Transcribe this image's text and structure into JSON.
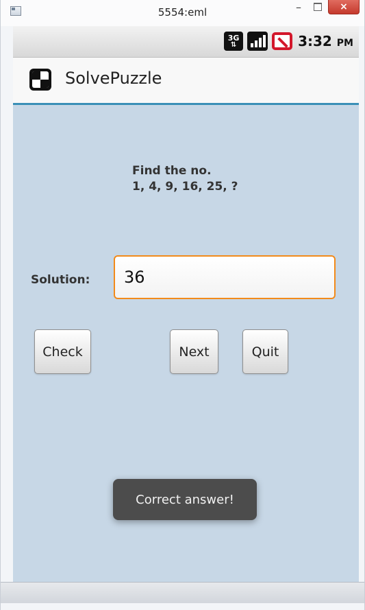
{
  "window": {
    "title": "5554:eml",
    "minimize_glyph": "–",
    "close_glyph": "×"
  },
  "statusbar": {
    "network_label": "3G",
    "time": "3:32",
    "ampm": "PM"
  },
  "app": {
    "title": "SolvePuzzle"
  },
  "puzzle": {
    "line1": "Find the no.",
    "line2": "1, 4, 9, 16, 25, ?"
  },
  "solution": {
    "label": "Solution:",
    "value": "36"
  },
  "buttons": {
    "check": "Check",
    "next": "Next",
    "quit": "Quit"
  },
  "toast": {
    "message": "Correct answer!"
  },
  "colors": {
    "background": "#c7d7e6",
    "accent": "#3a8fb7",
    "input_focus": "#f28a1a",
    "toast": "#4c4c4c"
  }
}
